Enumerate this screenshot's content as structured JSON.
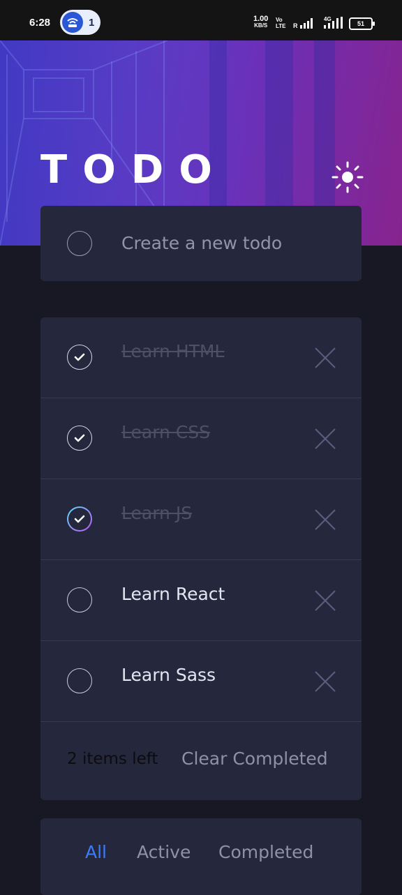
{
  "status_bar": {
    "time": "6:28",
    "hotspot_count": "1",
    "net_speed_value": "1.00",
    "net_speed_unit": "KB/S",
    "volte_line1": "Vo",
    "volte_line2": "LTE",
    "roaming": "R",
    "network_type": "4G",
    "battery_level": "51"
  },
  "header": {
    "title": "TODO",
    "theme_icon": "sun-icon"
  },
  "create": {
    "placeholder": "Create a new todo"
  },
  "todos": [
    {
      "text": "Learn HTML",
      "completed": true
    },
    {
      "text": "Learn CSS",
      "completed": true
    },
    {
      "text": "Learn JS",
      "completed": true
    },
    {
      "text": "Learn React",
      "completed": false
    },
    {
      "text": "Learn Sass",
      "completed": false
    }
  ],
  "footer": {
    "items_left": "2 items left",
    "clear_label": "Clear Completed"
  },
  "filters": [
    {
      "label": "All",
      "active": true
    },
    {
      "label": "Active",
      "active": false
    },
    {
      "label": "Completed",
      "active": false
    }
  ],
  "colors": {
    "accent": "#3a7cfd",
    "card": "#25273d",
    "background": "#171823",
    "check_gradient_start": "#57ddff",
    "check_gradient_end": "#c058f3"
  }
}
